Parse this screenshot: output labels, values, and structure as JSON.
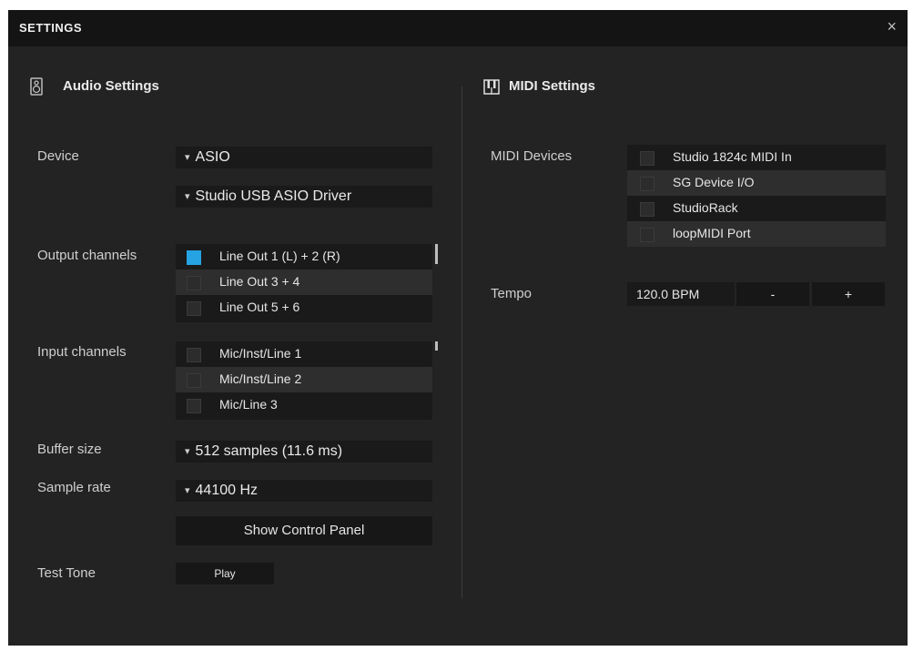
{
  "window": {
    "title": "SETTINGS",
    "close_glyph": "×"
  },
  "audio": {
    "title": "Audio Settings",
    "icon": "speaker-icon",
    "device_label": "Device",
    "device_type": "ASIO",
    "device_driver": "Studio USB ASIO Driver",
    "output_label": "Output channels",
    "output_channels": [
      {
        "label": "Line Out 1 (L) + 2 (R)",
        "checked": true
      },
      {
        "label": "Line Out 3 + 4",
        "checked": false
      },
      {
        "label": "Line Out 5 + 6",
        "checked": false
      }
    ],
    "input_label": "Input channels",
    "input_channels": [
      {
        "label": "Mic/Inst/Line 1",
        "checked": false
      },
      {
        "label": "Mic/Inst/Line 2",
        "checked": false
      },
      {
        "label": "Mic/Line 3",
        "checked": false
      }
    ],
    "buffer_label": "Buffer size",
    "buffer_value": "512 samples (11.6 ms)",
    "samplerate_label": "Sample rate",
    "samplerate_value": "44100 Hz",
    "control_panel_label": "Show Control Panel",
    "test_tone_label": "Test Tone",
    "play_label": "Play"
  },
  "midi": {
    "title": "MIDI Settings",
    "icon": "piano-keys-icon",
    "devices_label": "MIDI Devices",
    "devices": [
      {
        "label": "Studio 1824c MIDI In",
        "checked": false
      },
      {
        "label": "SG Device I/O",
        "checked": false
      },
      {
        "label": "StudioRack",
        "checked": false
      },
      {
        "label": "loopMIDI Port",
        "checked": false
      }
    ],
    "tempo_label": "Tempo",
    "tempo_value": "120.0 BPM",
    "tempo_minus": "-",
    "tempo_plus": "+"
  },
  "colors": {
    "accent": "#25a3e3",
    "background": "#232323",
    "titlebar": "#141414",
    "field": "#1a1a1a"
  }
}
